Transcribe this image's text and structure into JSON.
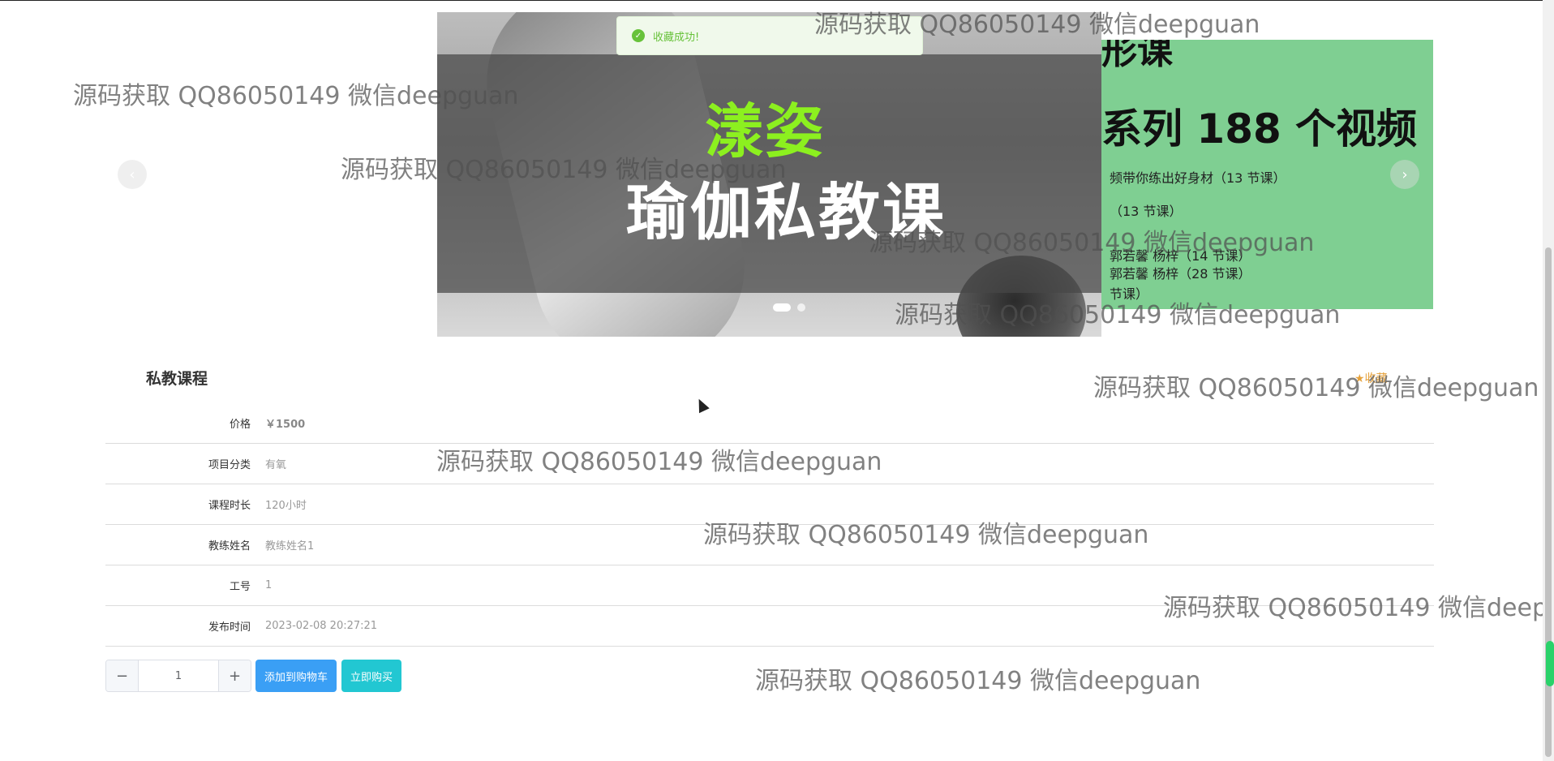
{
  "carousel": {
    "main_slide": {
      "title_line1": "漾姿",
      "title_line2": "瑜伽私教课"
    },
    "side_slide": {
      "top_text": "形课",
      "line1": "系列 188 个视频",
      "lines": [
        "频带你练出好身材（13 节课）",
        "（13 节课）",
        "郭若馨 杨梓（14 节课）",
        "郭若馨 杨梓（28 节课）",
        "节课）"
      ]
    },
    "prev_icon": "chevron-left-icon",
    "next_icon": "chevron-right-icon",
    "active_index": 0,
    "slide_count": 2
  },
  "toast": {
    "text": "收藏成功!",
    "icon": "check-circle-icon",
    "color": "#67c23a"
  },
  "detail": {
    "title": "私教课程",
    "favorite_label": "★收藏",
    "rows": [
      {
        "label": "价格",
        "value": "￥1500"
      },
      {
        "label": "项目分类",
        "value": "有氧"
      },
      {
        "label": "课程时长",
        "value": "120小时"
      },
      {
        "label": "教练姓名",
        "value": "教练姓名1"
      },
      {
        "label": "工号",
        "value": "1"
      },
      {
        "label": "发布时间",
        "value": "2023-02-08 20:27:21"
      }
    ]
  },
  "purchase": {
    "minus": "−",
    "quantity": "1",
    "plus": "+",
    "add_to_cart": "添加到购物车",
    "buy_now": "立即购买"
  },
  "watermark": "源码获取 QQ86050149 微信deepguan",
  "colors": {
    "primary": "#3a9ff5",
    "buy": "#22c7d2",
    "success": "#67c23a",
    "favorite": "#e6a23c"
  }
}
